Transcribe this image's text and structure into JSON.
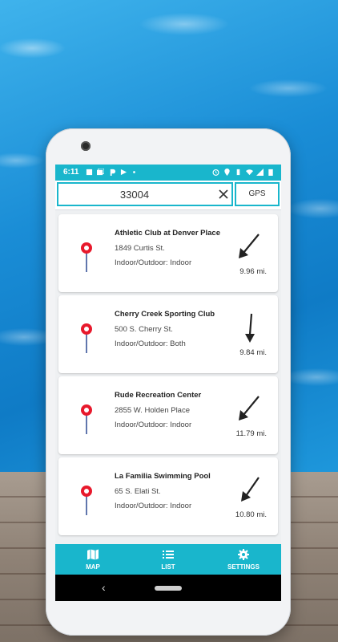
{
  "status_bar": {
    "time": "6:11"
  },
  "search": {
    "value": "33004",
    "gps_label": "GPS"
  },
  "pools": [
    {
      "name": "Athletic Club at Denver Place",
      "address": "1849 Curtis St.",
      "indoor_outdoor": "Indoor/Outdoor: Indoor",
      "distance": "9.96 mi.",
      "direction": "southwest"
    },
    {
      "name": "Cherry Creek Sporting Club",
      "address": "500 S. Cherry St.",
      "indoor_outdoor": "Indoor/Outdoor: Both",
      "distance": "9.84 mi.",
      "direction": "south"
    },
    {
      "name": "Rude Recreation Center",
      "address": "2855 W. Holden Place",
      "indoor_outdoor": "Indoor/Outdoor: Indoor",
      "distance": "11.79 mi.",
      "direction": "southwest"
    },
    {
      "name": "La Familia Swimming Pool",
      "address": "65 S. Elati St.",
      "indoor_outdoor": "Indoor/Outdoor: Indoor",
      "distance": "10.80 mi.",
      "direction": "southwest"
    }
  ],
  "nav": {
    "map": "MAP",
    "list": "LIST",
    "settings": "SETTINGS"
  },
  "colors": {
    "accent": "#19b6cc",
    "pin": "#e8192c",
    "pin_line": "#1b3a8a"
  },
  "icons": {
    "pin": "map-pin-icon",
    "direction": "direction-arrow-icon",
    "clear": "close-icon",
    "map": "map-icon",
    "list": "list-icon",
    "settings": "gear-icon"
  }
}
